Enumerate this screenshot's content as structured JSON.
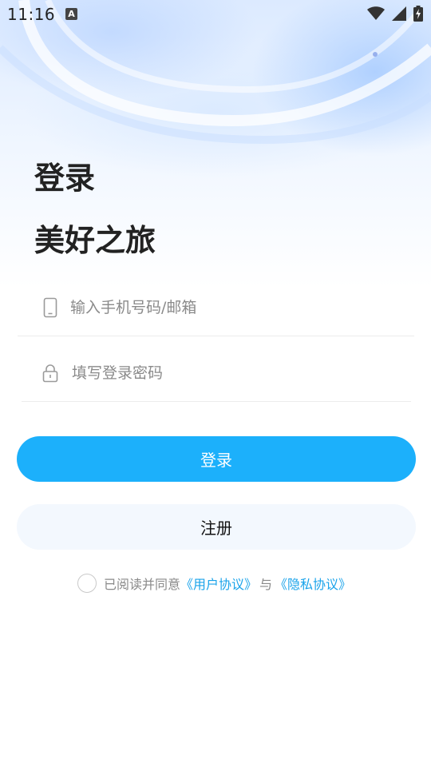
{
  "status_bar": {
    "time": "11:16",
    "notification_icon": "A",
    "icons": [
      "wifi-icon",
      "signal-icon",
      "battery-charging-icon"
    ]
  },
  "header": {
    "title": "登录",
    "slogan": "美好之旅"
  },
  "form": {
    "phone_placeholder": "输入手机号码/邮箱",
    "password_placeholder": "填写登录密码",
    "phone_icon": "phone-icon",
    "password_icon": "lock-icon"
  },
  "actions": {
    "login_label": "登录",
    "register_label": "注册"
  },
  "agreement": {
    "prefix": "已阅读并同意",
    "user_agreement": "《用户协议》",
    "conjunction": "与",
    "privacy_policy": "《隐私协议》"
  },
  "colors": {
    "primary": "#1cb0fb",
    "register_bg": "#f3f8fe",
    "link": "#1aa3ea"
  }
}
